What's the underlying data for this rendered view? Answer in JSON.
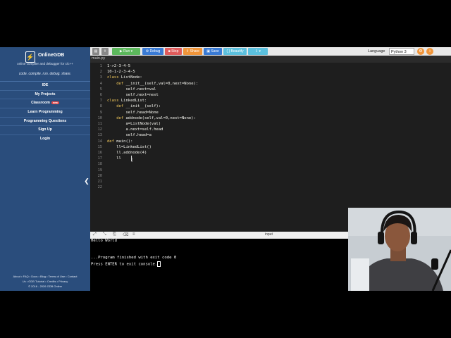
{
  "sidebar": {
    "logo": "OnlineGDB",
    "tagline": "online compiler and debugger for c/c++",
    "slogan": "code. compile. run. debug. share.",
    "items": [
      {
        "label": "IDE"
      },
      {
        "label": "My Projects"
      },
      {
        "label": "Classroom",
        "badge": "new"
      },
      {
        "label": "Learn Programming"
      },
      {
        "label": "Programming Questions"
      },
      {
        "label": "Sign Up"
      },
      {
        "label": "Login"
      }
    ],
    "footer_line1": "About • FAQ • Docs • Blog • Terms of Use • Contact",
    "footer_line2": "Us • GDB Tutorial • Credits • Privacy",
    "footer_line3": "© 2016 - 2026 GDB Online"
  },
  "toolbar": {
    "run": "Run",
    "debug": "Debug",
    "stop": "Stop",
    "share": "Share",
    "save": "Save",
    "beautify": "{ } Beautify",
    "language_label": "Language",
    "language_value": "Python 3"
  },
  "editor": {
    "filename": "main.py",
    "line_numbers": [
      "1",
      "2",
      "3",
      "4",
      "5",
      "6",
      "7",
      "8",
      "9",
      "10",
      "11",
      "12",
      "13",
      "14",
      "15",
      "16",
      "17",
      "18",
      "19",
      "20",
      "21",
      "22"
    ]
  },
  "code": {
    "l1": "1->2-3-4-5",
    "l2": "10-1-2-3-4-5",
    "l3a": "class ",
    "l3b": "ListNode:",
    "l4a": "    def ",
    "l4b": "__init__(self,val=0,next=None):",
    "l5": "        self.next=val",
    "l6": "        self.next=next",
    "l7a": "class ",
    "l7b": "LinkedList:",
    "l8a": "    def ",
    "l8b": "__init__(self):",
    "l9": "        self.head=None",
    "l10a": "    def ",
    "l10b": "addnode(self,val=0,next=None):",
    "l11": "        a=ListNode(val)",
    "l12": "        a.next=self.head",
    "l13": "        self.head=a",
    "l14a": "def ",
    "l14b": "main():",
    "l15": "    ll=LinkedList()",
    "l16": "    ll.addnode(4)",
    "l17": "    ll"
  },
  "console": {
    "input_label": "input",
    "line1": "Hello World",
    "line2": "...Program finished with exit code 0",
    "line3": "Press ENTER to exit console."
  },
  "colors": {
    "sidebar": "#2a4d7c",
    "run": "#5cb85c",
    "debug": "#3a7bd5",
    "stop": "#e05c5c",
    "share": "#f0953a",
    "save": "#3a7bd5",
    "beautify": "#5bc0de",
    "keyword": "#f5cb5c"
  }
}
